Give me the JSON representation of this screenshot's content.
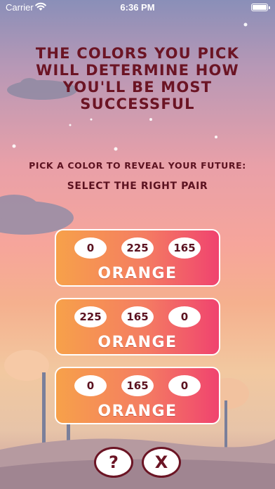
{
  "status_bar": {
    "carrier": "Carrier",
    "time": "6:36 PM"
  },
  "headline": "THE COLORS YOU PICK WILL DETERMINE HOW YOU'LL BE MOST SUCCESSFUL",
  "instruction": "PICK A COLOR TO REVEAL YOUR FUTURE:",
  "prompt": "SELECT THE RIGHT PAIR",
  "options": [
    {
      "values": [
        "0",
        "225",
        "165"
      ],
      "label": "ORANGE"
    },
    {
      "values": [
        "225",
        "165",
        "0"
      ],
      "label": "ORANGE"
    },
    {
      "values": [
        "0",
        "165",
        "0"
      ],
      "label": "ORANGE"
    }
  ],
  "buttons": {
    "help": "?",
    "close": "X"
  },
  "colors": {
    "accent": "#6b1424",
    "option_start": "#f7a14a",
    "option_end": "#f0436f"
  }
}
